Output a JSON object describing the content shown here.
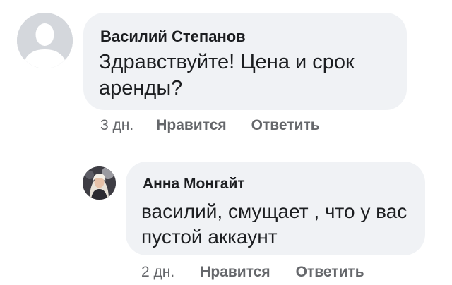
{
  "comments": [
    {
      "author": "Василий Степанов",
      "text": "Здравствуйте! Цена и срок аренды?",
      "time": "3 дн.",
      "like_label": "Нравится",
      "reply_label": "Ответить",
      "avatar_icon": "default-profile-silhouette-icon"
    },
    {
      "author": "Анна Монгайт",
      "text": "василий, смущает , что у вас пустой аккаунт",
      "time": "2 дн.",
      "like_label": "Нравится",
      "reply_label": "Ответить",
      "avatar_icon": "profile-photo"
    }
  ],
  "colors": {
    "bubble_bg": "#f0f2f5",
    "text": "#1c1e21",
    "meta": "#65676b",
    "default_avatar_bg": "#d4d7dc"
  }
}
